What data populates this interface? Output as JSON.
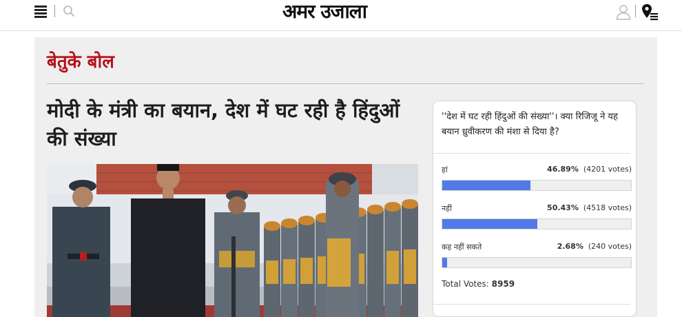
{
  "header": {
    "logo_text": "अमर उजाला"
  },
  "section": {
    "title": "बेतुके बोल"
  },
  "article": {
    "headline": "मोदी के मंत्री का बयान, देश में घट रही है हिंदुओं की संख्या"
  },
  "poll": {
    "question": "''देश में घट रही हिंदुओं की संख्या''। क्या रिजिजू ने यह बयान ध्रुवीकरण की मंशा से दिया है?",
    "options": [
      {
        "label": "हां",
        "percent": "46.89%",
        "votes": "(4201 votes)",
        "fraction": 0.4689
      },
      {
        "label": "नहीं",
        "percent": "50.43%",
        "votes": "(4518 votes)",
        "fraction": 0.5043
      },
      {
        "label": "कह नहीं सकते",
        "percent": "2.68%",
        "votes": "(240 votes)",
        "fraction": 0.0268
      }
    ],
    "total_label": "Total Votes:",
    "total_value": "8959",
    "bar_color": "#4f7ae8"
  },
  "icons": {
    "menu": "menu-icon",
    "search": "search-icon",
    "user": "user-icon",
    "location": "location-icon"
  }
}
